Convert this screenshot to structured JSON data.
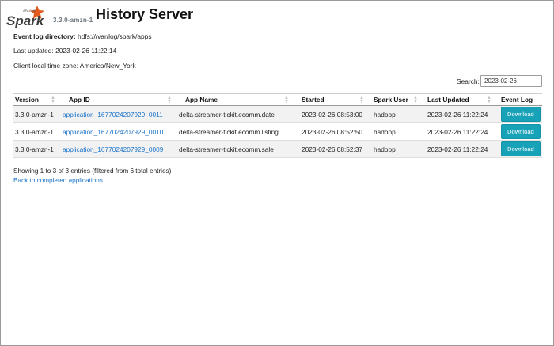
{
  "header": {
    "logo_text": "Spark",
    "logo_subtext": "APACHE",
    "version": "3.3.0-amzn-1",
    "title": "History Server"
  },
  "info": {
    "event_log_label": "Event log directory:",
    "event_log_value": "hdfs:///var/log/spark/apps",
    "last_updated": "Last updated: 2023-02-26 11:22:14",
    "timezone": "Client local time zone: America/New_York"
  },
  "search": {
    "label": "Search:",
    "value": "2023-02-26"
  },
  "table": {
    "columns": [
      "Version",
      "App ID",
      "App Name",
      "Started",
      "Spark User",
      "Last Updated",
      "Event Log"
    ],
    "rows": [
      {
        "version": "3.3.0-amzn-1",
        "app_id": "application_1677024207929_0011",
        "app_name": "delta-streamer-tickit.ecomm.date",
        "started": "2023-02-26 08:53:00",
        "user": "hadoop",
        "last_updated": "2023-02-26 11:22:24",
        "event_log": "Download"
      },
      {
        "version": "3.3.0-amzn-1",
        "app_id": "application_1677024207929_0010",
        "app_name": "delta-streamer-tickit.ecomm.listing",
        "started": "2023-02-26 08:52:50",
        "user": "hadoop",
        "last_updated": "2023-02-26 11:22:24",
        "event_log": "Download"
      },
      {
        "version": "3.3.0-amzn-1",
        "app_id": "application_1677024207929_0009",
        "app_name": "delta-streamer-tickit.ecomm.sale",
        "started": "2023-02-26 08:52:37",
        "user": "hadoop",
        "last_updated": "2023-02-26 11:22:24",
        "event_log": "Download"
      }
    ]
  },
  "footer": {
    "entries_info": "Showing 1 to 3 of 3 entries (filtered from 6 total entries)",
    "back_link": "Back to completed applications"
  },
  "colors": {
    "link": "#1a73c8",
    "download_button": "#17a2b8",
    "spark_star": "#e25a1c"
  }
}
